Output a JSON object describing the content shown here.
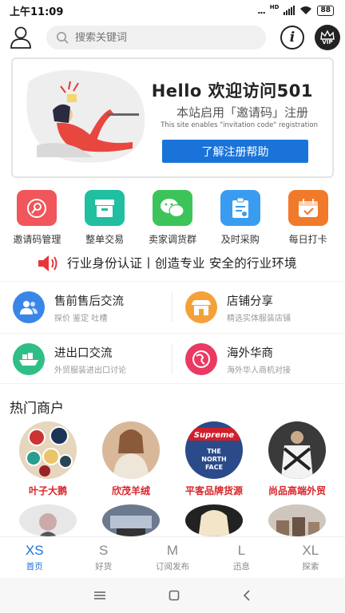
{
  "status_bar": {
    "time": "上午11:09",
    "dots": "...",
    "network": "HD",
    "battery": "88"
  },
  "header": {
    "search_placeholder": "搜索关键词",
    "info_icon_glyph": "i",
    "vip_text": "VIP"
  },
  "banner": {
    "title": "Hello 欢迎访问501",
    "subtitle": "本站启用「邀请码」注册",
    "subtitle_en": "This site enables \"invitation code\" registration",
    "button": "了解注册帮助"
  },
  "quick_links": [
    {
      "label": "邀请码管理",
      "icon": "search-icon",
      "color": "#f0565a"
    },
    {
      "label": "整单交易",
      "icon": "box-icon",
      "color": "#1fbfa0"
    },
    {
      "label": "卖家调货群",
      "icon": "wechat-icon",
      "color": "#3cc45a"
    },
    {
      "label": "及时采购",
      "icon": "clipboard-icon",
      "color": "#3a9cf0"
    },
    {
      "label": "每日打卡",
      "icon": "calendar-icon",
      "color": "#f07a2a"
    }
  ],
  "announcement": "行业身份认证丨创造专业 安全的行业环境",
  "features": [
    {
      "title": "售前售后交流",
      "sub": "探价 鉴定 吐槽",
      "icon": "users-icon",
      "color": "#3a86e8"
    },
    {
      "title": "店铺分享",
      "sub": "精选实体服装店铺",
      "icon": "store-icon",
      "color": "#f5a13a"
    },
    {
      "title": "进出口交流",
      "sub": "外贸服装进出口讨论",
      "icon": "ship-icon",
      "color": "#2fbf86"
    },
    {
      "title": "海外华商",
      "sub": "海外华人商机对接",
      "icon": "globe-icon",
      "color": "#ea3a62"
    }
  ],
  "hot_section": {
    "title": "热门商户"
  },
  "merchants": [
    {
      "name": "叶子大鹅"
    },
    {
      "name": "欣茂羊绒"
    },
    {
      "name": "平客品牌货源"
    },
    {
      "name": "尚品高端外贸"
    }
  ],
  "merchant_logo_texts": {
    "supreme": "Supreme",
    "tnf_1": "THE",
    "tnf_2": "NORTH",
    "tnf_3": "FACE"
  },
  "tabs": [
    {
      "letter": "XS",
      "label": "首页",
      "active": true
    },
    {
      "letter": "S",
      "label": "好货"
    },
    {
      "letter": "M",
      "label": "订阅发布"
    },
    {
      "letter": "L",
      "label": "迅息"
    },
    {
      "letter": "XL",
      "label": "探索"
    }
  ],
  "colors": {
    "accent": "#1a73d9",
    "merchant_name": "#d8262a"
  }
}
